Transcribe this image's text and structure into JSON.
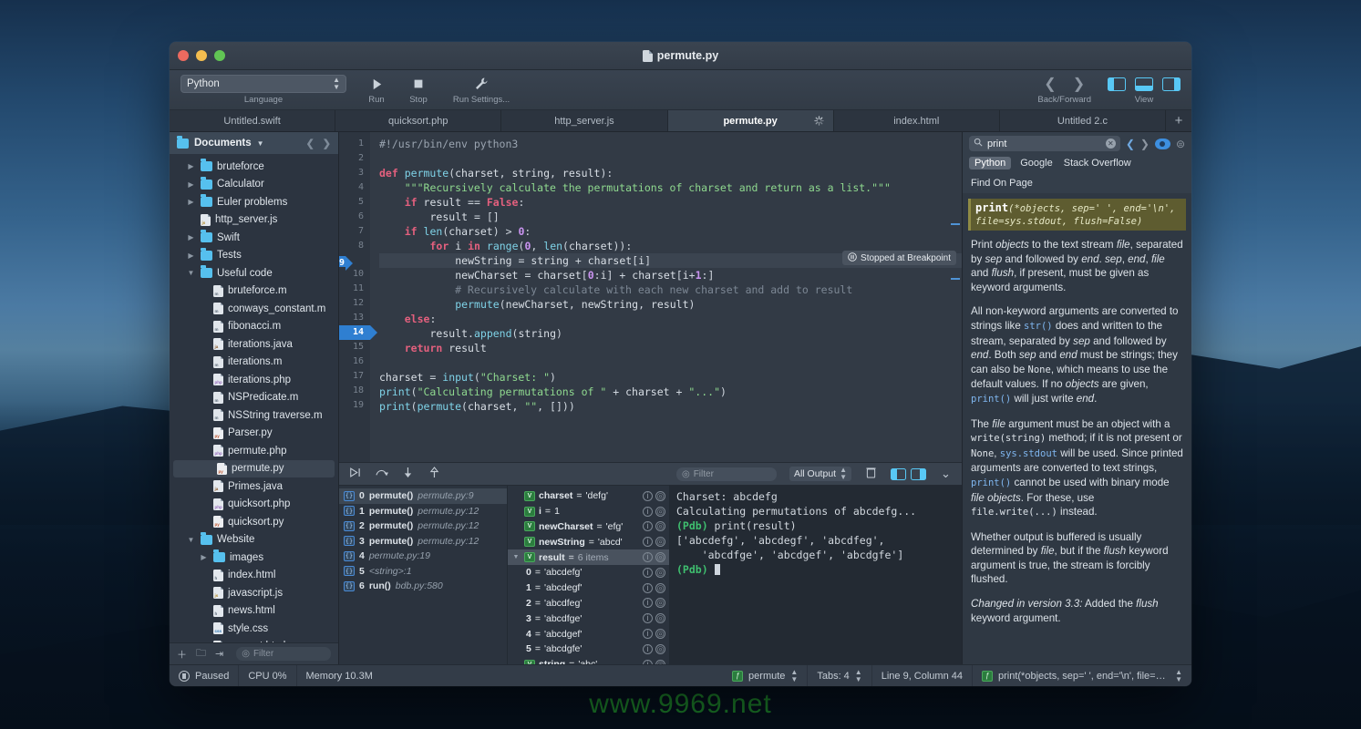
{
  "window": {
    "title": "permute.py"
  },
  "toolbar": {
    "language_value": "Python",
    "language_caption": "Language",
    "run_label": "Run",
    "stop_label": "Stop",
    "run_settings_label": "Run Settings...",
    "back_forward_caption": "Back/Forward",
    "view_caption": "View"
  },
  "tabs": [
    {
      "label": "Untitled.swift",
      "active": false
    },
    {
      "label": "quicksort.php",
      "active": false
    },
    {
      "label": "http_server.js",
      "active": false
    },
    {
      "label": "permute.py",
      "active": true
    },
    {
      "label": "index.html",
      "active": false
    },
    {
      "label": "Untitled 2.c",
      "active": false
    }
  ],
  "tab_add_label": "+",
  "sidebar": {
    "root_label": "Documents",
    "filter_placeholder": "Filter",
    "items": [
      {
        "label": "bruteforce",
        "type": "folder",
        "indent": 1,
        "disclosure": "closed"
      },
      {
        "label": "Calculator",
        "type": "folder",
        "indent": 1,
        "disclosure": "closed"
      },
      {
        "label": "Euler problems",
        "type": "folder",
        "indent": 1,
        "disclosure": "closed"
      },
      {
        "label": "http_server.js",
        "type": "js",
        "indent": 1,
        "disclosure": "none"
      },
      {
        "label": "Swift",
        "type": "folder",
        "indent": 1,
        "disclosure": "closed"
      },
      {
        "label": "Tests",
        "type": "folder",
        "indent": 1,
        "disclosure": "closed"
      },
      {
        "label": "Useful code",
        "type": "folder",
        "indent": 1,
        "disclosure": "open"
      },
      {
        "label": "bruteforce.m",
        "type": "m",
        "indent": 2,
        "disclosure": "none"
      },
      {
        "label": "conways_constant.m",
        "type": "m",
        "indent": 2,
        "disclosure": "none"
      },
      {
        "label": "fibonacci.m",
        "type": "m",
        "indent": 2,
        "disclosure": "none"
      },
      {
        "label": "iterations.java",
        "type": "java",
        "indent": 2,
        "disclosure": "none"
      },
      {
        "label": "iterations.m",
        "type": "m",
        "indent": 2,
        "disclosure": "none"
      },
      {
        "label": "iterations.php",
        "type": "php",
        "indent": 2,
        "disclosure": "none"
      },
      {
        "label": "NSPredicate.m",
        "type": "m",
        "indent": 2,
        "disclosure": "none"
      },
      {
        "label": "NSString traverse.m",
        "type": "m",
        "indent": 2,
        "disclosure": "none"
      },
      {
        "label": "Parser.py",
        "type": "py",
        "indent": 2,
        "disclosure": "none"
      },
      {
        "label": "permute.php",
        "type": "php",
        "indent": 2,
        "disclosure": "none"
      },
      {
        "label": "permute.py",
        "type": "py",
        "indent": 2,
        "disclosure": "none",
        "selected": true
      },
      {
        "label": "Primes.java",
        "type": "java",
        "indent": 2,
        "disclosure": "none"
      },
      {
        "label": "quicksort.php",
        "type": "php",
        "indent": 2,
        "disclosure": "none"
      },
      {
        "label": "quicksort.py",
        "type": "py",
        "indent": 2,
        "disclosure": "none"
      },
      {
        "label": "Website",
        "type": "folder",
        "indent": 1,
        "disclosure": "open"
      },
      {
        "label": "images",
        "type": "folder",
        "indent": 2,
        "disclosure": "closed"
      },
      {
        "label": "index.html",
        "type": "html",
        "indent": 2,
        "disclosure": "none"
      },
      {
        "label": "javascript.js",
        "type": "js",
        "indent": 2,
        "disclosure": "none"
      },
      {
        "label": "news.html",
        "type": "html",
        "indent": 2,
        "disclosure": "none"
      },
      {
        "label": "style.css",
        "type": "css",
        "indent": 2,
        "disclosure": "none"
      },
      {
        "label": "support.html",
        "type": "html",
        "indent": 2,
        "disclosure": "none"
      }
    ]
  },
  "editor": {
    "breakpoint_badge": "Stopped at Breakpoint",
    "current_line": 9,
    "breakpoint_line": 14,
    "lines": [
      {
        "n": 1,
        "text": "#!/usr/bin/env python3"
      },
      {
        "n": 2,
        "text": ""
      },
      {
        "n": 3,
        "text": "def permute(charset, string, result):"
      },
      {
        "n": 4,
        "text": "    \"\"\"Recursively calculate the permutations of charset and return as a list.\"\"\""
      },
      {
        "n": 5,
        "text": "    if result == False:"
      },
      {
        "n": 6,
        "text": "        result = []"
      },
      {
        "n": 7,
        "text": "    if len(charset) > 0:"
      },
      {
        "n": 8,
        "text": "        for i in range(0, len(charset)):"
      },
      {
        "n": 9,
        "text": "            newString = string + charset[i]"
      },
      {
        "n": 10,
        "text": "            newCharset = charset[0:i] + charset[i+1:]"
      },
      {
        "n": 11,
        "text": "            # Recursively calculate with each new charset and add to result"
      },
      {
        "n": 12,
        "text": "            permute(newCharset, newString, result)"
      },
      {
        "n": 13,
        "text": "    else:"
      },
      {
        "n": 14,
        "text": "        result.append(string)"
      },
      {
        "n": 15,
        "text": "    return result"
      },
      {
        "n": 16,
        "text": ""
      },
      {
        "n": 17,
        "text": "charset = input(\"Charset: \")"
      },
      {
        "n": 18,
        "text": "print(\"Calculating permutations of \" + charset + \"...\")"
      },
      {
        "n": 19,
        "text": "print(permute(charset, \"\", []))"
      }
    ]
  },
  "debug_toolbar": {
    "filter_placeholder": "Filter",
    "output_scope": "All Output"
  },
  "stack": [
    {
      "index": "0",
      "fn": "permute()",
      "loc": "permute.py:9",
      "selected": true
    },
    {
      "index": "1",
      "fn": "permute()",
      "loc": "permute.py:12",
      "selected": false
    },
    {
      "index": "2",
      "fn": "permute()",
      "loc": "permute.py:12",
      "selected": false
    },
    {
      "index": "3",
      "fn": "permute()",
      "loc": "permute.py:12",
      "selected": false
    },
    {
      "index": "4",
      "fn": "",
      "loc": "permute.py:19",
      "selected": false
    },
    {
      "index": "5",
      "fn": "",
      "loc": "<string>:1",
      "selected": false
    },
    {
      "index": "6",
      "fn": "run()",
      "loc": "bdb.py:580",
      "selected": false
    }
  ],
  "variables": [
    {
      "name": "charset",
      "value": "'defg'",
      "kind": "var",
      "indent": 0,
      "disclosure": "none"
    },
    {
      "name": "i",
      "value": "1",
      "kind": "var",
      "indent": 0,
      "disclosure": "none"
    },
    {
      "name": "newCharset",
      "value": "'efg'",
      "kind": "var",
      "indent": 0,
      "disclosure": "none"
    },
    {
      "name": "newString",
      "value": "'abcd'",
      "kind": "var",
      "indent": 0,
      "disclosure": "none"
    },
    {
      "name": "result",
      "value": "6 items",
      "kind": "var",
      "indent": 0,
      "disclosure": "open",
      "selected": true,
      "dim": true
    },
    {
      "name": "0",
      "value": "'abcdefg'",
      "kind": "child",
      "indent": 1,
      "disclosure": "none"
    },
    {
      "name": "1",
      "value": "'abcdegf'",
      "kind": "child",
      "indent": 1,
      "disclosure": "none"
    },
    {
      "name": "2",
      "value": "'abcdfeg'",
      "kind": "child",
      "indent": 1,
      "disclosure": "none"
    },
    {
      "name": "3",
      "value": "'abcdfge'",
      "kind": "child",
      "indent": 1,
      "disclosure": "none"
    },
    {
      "name": "4",
      "value": "'abcdgef'",
      "kind": "child",
      "indent": 1,
      "disclosure": "none"
    },
    {
      "name": "5",
      "value": "'abcdgfe'",
      "kind": "child",
      "indent": 1,
      "disclosure": "none"
    },
    {
      "name": "string",
      "value": "'abc'",
      "kind": "var",
      "indent": 0,
      "disclosure": "none"
    }
  ],
  "console": {
    "lines": [
      {
        "text": "Charset: abcdefg",
        "type": "plain"
      },
      {
        "text": "Calculating permutations of abcdefg...",
        "type": "plain"
      },
      {
        "prompt": "(Pdb)",
        "text": " print(result)",
        "type": "prompt"
      },
      {
        "text": "['abcdefg', 'abcdegf', 'abcdfeg',",
        "type": "plain"
      },
      {
        "text": "    'abcdfge', 'abcdgef', 'abcdgfe']",
        "type": "plain"
      },
      {
        "prompt": "(Pdb)",
        "text": " ",
        "type": "cursor"
      }
    ]
  },
  "docs": {
    "search_value": "print",
    "scopes": [
      "Python",
      "Google",
      "Stack Overflow",
      "Find On Page"
    ],
    "active_scope": "Python",
    "signature_name": "print",
    "signature_args": "(*objects, sep=' ', end='\\n', file=sys.stdout, flush=False)",
    "paragraphs": [
      "Print objects to the text stream file, separated by sep and followed by end. sep, end, file and flush, if present, must be given as keyword arguments.",
      "All non-keyword arguments are converted to strings like str() does and written to the stream, separated by sep and followed by end. Both sep and end must be strings; they can also be None, which means to use the default values. If no objects are given, print() will just write end.",
      "The file argument must be an object with a write(string) method; if it is not present or None, sys.stdout will be used. Since printed arguments are converted to text strings, print() cannot be used with binary mode file objects. For these, use file.write(...) instead.",
      "Whether output is buffered is usually determined by file, but if the flush keyword argument is true, the stream is forcibly flushed.",
      "Changed in version 3.3: Added the flush keyword argument."
    ]
  },
  "statusbar": {
    "paused_label": "Paused",
    "cpu_label": "CPU 0%",
    "memory_label": "Memory 10.3M",
    "symbol_label": "permute",
    "tabs_label": "Tabs: 4",
    "position_label": "Line 9, Column 44",
    "signature_label": "print(*objects, sep=' ', end='\\n', file=sys.st..."
  },
  "watermark": "www.9969.net"
}
